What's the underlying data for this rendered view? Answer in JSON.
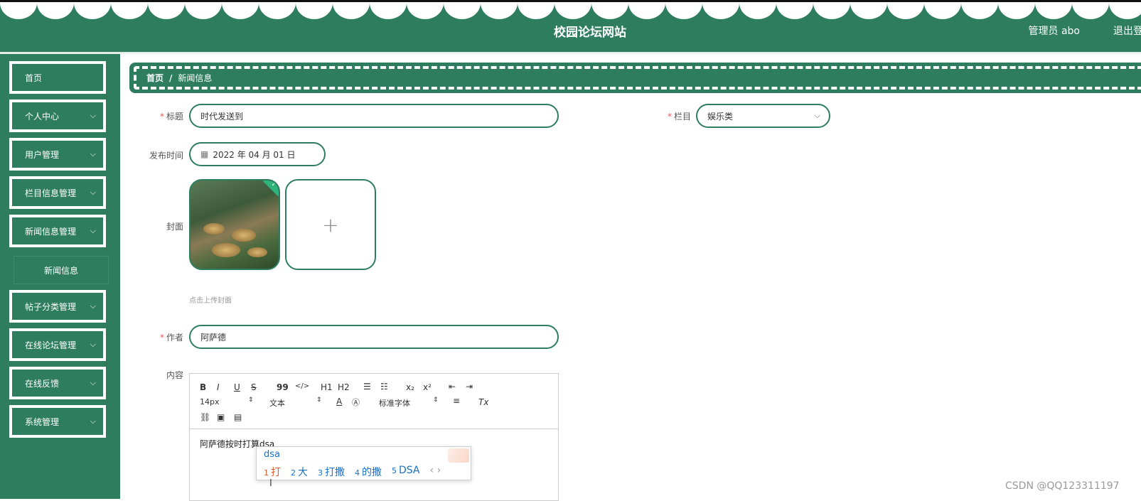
{
  "header": {
    "title": "校园论坛网站",
    "user": "管理员 abo",
    "logout": "退出登"
  },
  "sidebar": {
    "items": [
      {
        "label": "首页",
        "has_arrow": false
      },
      {
        "label": "个人中心",
        "has_arrow": true
      },
      {
        "label": "用户管理",
        "has_arrow": true
      },
      {
        "label": "栏目信息管理",
        "has_arrow": true
      },
      {
        "label": "新闻信息管理",
        "has_arrow": true
      },
      {
        "label": "帖子分类管理",
        "has_arrow": true
      },
      {
        "label": "在线论坛管理",
        "has_arrow": true
      },
      {
        "label": "在线反馈",
        "has_arrow": true
      },
      {
        "label": "系统管理",
        "has_arrow": true
      }
    ],
    "submenu": "新闻信息"
  },
  "breadcrumb": {
    "home": "首页",
    "separator": "/",
    "current": "新闻信息"
  },
  "form": {
    "title_label": "标题",
    "title_value": "时代发送到",
    "column_label": "栏目",
    "column_value": "娱乐类",
    "date_label": "发布时间",
    "date_value": "2022 年 04 月 01 日",
    "cover_label": "封面",
    "cover_hint": "点击上传封面",
    "upload_plus": "+",
    "author_label": "作者",
    "author_value": "阿萨德",
    "content_label": "内容",
    "required_mark": "*"
  },
  "editor": {
    "toolbar": {
      "bold": "B",
      "italic": "I",
      "underline": "U",
      "strike": "S",
      "quote": "99",
      "code": "</>",
      "h1": "H1",
      "h2": "H2",
      "sub": "x₂",
      "sup": "x²",
      "font_size": "14px",
      "font_type": "文本",
      "font_family": "标准字体",
      "clear": "Tx"
    },
    "content": "阿萨德按时打算dsa"
  },
  "ime": {
    "input": "dsa",
    "candidates": [
      {
        "n": "1",
        "text": "打"
      },
      {
        "n": "2",
        "text": "大"
      },
      {
        "n": "3",
        "text": "打撒"
      },
      {
        "n": "4",
        "text": "的撒"
      },
      {
        "n": "5",
        "text": "DSA"
      }
    ],
    "nav": "‹ ›"
  },
  "watermark": "CSDN @QQ123311197",
  "colors": {
    "primary": "#2e7d5f",
    "required": "#e55555",
    "ime_highlight": "#e05a2a",
    "ime_text": "#1a6fc7"
  }
}
